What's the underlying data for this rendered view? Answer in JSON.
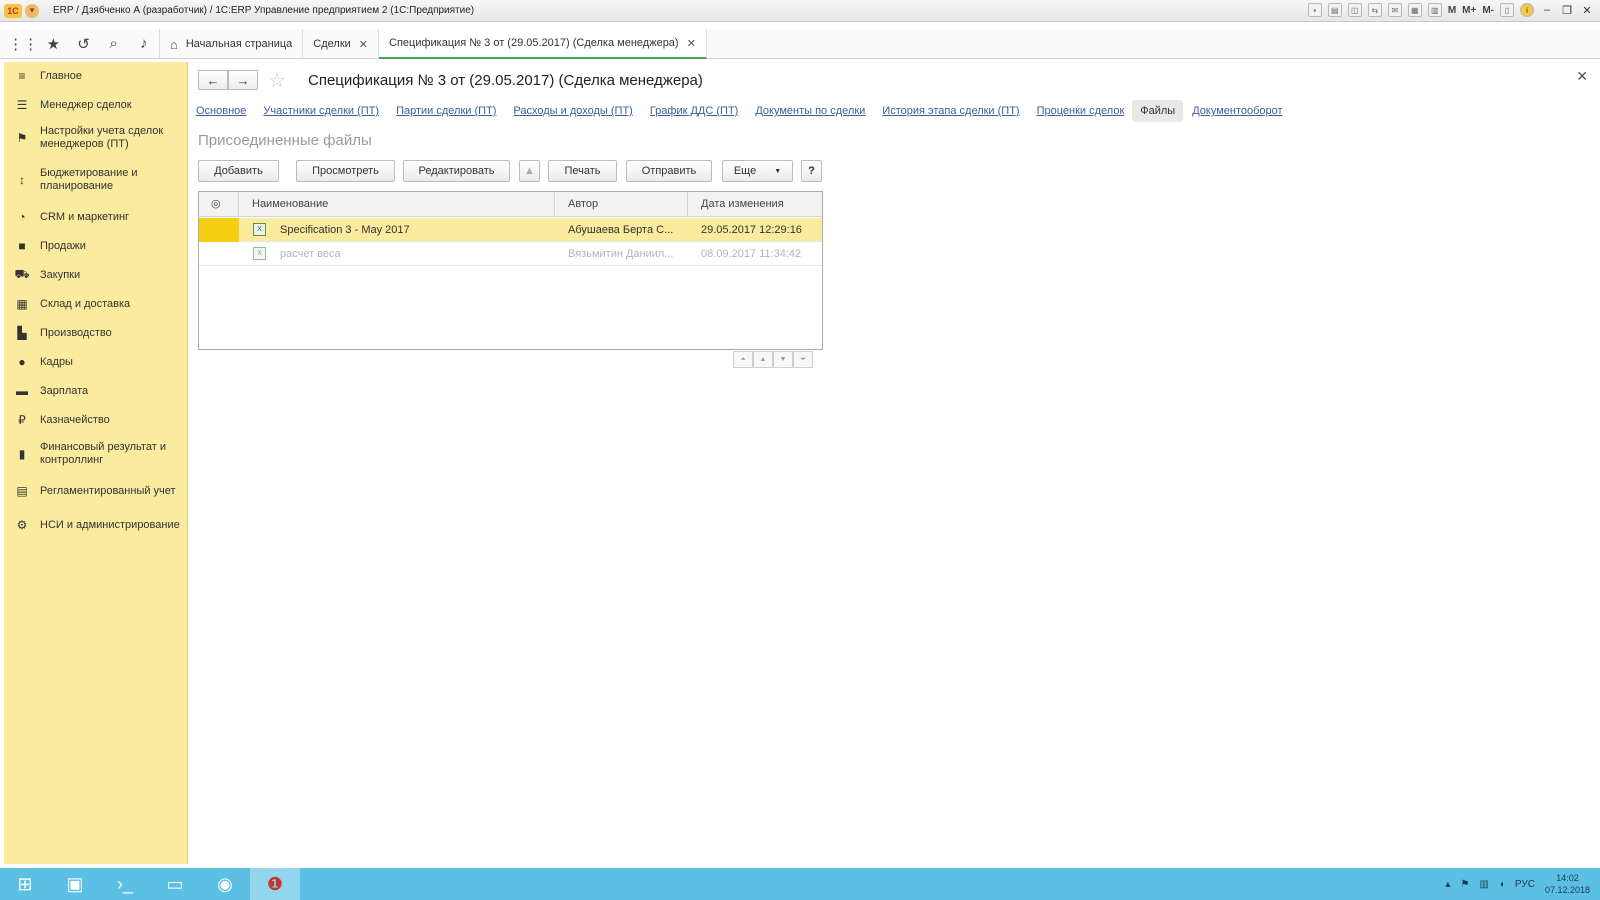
{
  "window": {
    "title": "ERP / Дзябченко А (разработчик) / 1С:ERP Управление предприятием 2  (1С:Предприятие)",
    "right_labels": [
      "M",
      "M+",
      "M-"
    ]
  },
  "tabs": [
    {
      "label": "Начальная страница",
      "icon": "home-icon"
    },
    {
      "label": "Сделки",
      "icon": "close-icon"
    },
    {
      "label": "Спецификация № 3  от (29.05.2017) (Сделка менеджера)",
      "icon": "close-icon",
      "active": true
    }
  ],
  "sidebar": {
    "items": [
      {
        "label": "Главное",
        "icon": "menu-lines-icon"
      },
      {
        "label": "Менеджер сделок",
        "icon": "list-icon"
      },
      {
        "label": "Настройки учета сделок менеджеров (ПТ)",
        "icon": "flag-icon"
      },
      {
        "label": "Бюджетирование и планирование",
        "icon": "budget-icon"
      },
      {
        "label": "CRM и маркетинг",
        "icon": "pie-icon"
      },
      {
        "label": "Продажи",
        "icon": "bag-icon"
      },
      {
        "label": "Закупки",
        "icon": "cart-icon"
      },
      {
        "label": "Склад и доставка",
        "icon": "grid-icon"
      },
      {
        "label": "Производство",
        "icon": "factory-icon"
      },
      {
        "label": "Кадры",
        "icon": "person-icon"
      },
      {
        "label": "Зарплата",
        "icon": "card-icon"
      },
      {
        "label": "Казначейство",
        "icon": "ruble-icon"
      },
      {
        "label": "Финансовый результат и контроллинг",
        "icon": "bar-chart-icon"
      },
      {
        "label": "Регламентированный учет",
        "icon": "ledger-icon"
      },
      {
        "label": "НСИ и администрирование",
        "icon": "gear-icon"
      }
    ]
  },
  "document": {
    "title": "Спецификация № 3  от (29.05.2017) (Сделка менеджера)",
    "subtabs": [
      "Основное",
      "Участники сделки (ПТ)",
      "Партии сделки (ПТ)",
      "Расходы и доходы (ПТ)",
      "График ДДС (ПТ)",
      "Документы по сделки",
      "История этапа сделки (ПТ)",
      "Проценки сделок",
      "Файлы",
      "Документооборот"
    ],
    "section_title": "Присоединенные файлы"
  },
  "commands": {
    "add": "Добавить",
    "view": "Просмотреть",
    "edit": "Редактировать",
    "print": "Печать",
    "send": "Отправить",
    "more": "Еще",
    "help": "?"
  },
  "files_table": {
    "columns": [
      "Наименование",
      "Автор",
      "Дата изменения"
    ],
    "rows": [
      {
        "name": "Specification 3 - May 2017",
        "author": "Абушаева Берта С...",
        "modified": "29.05.2017 12:29:16",
        "selected": true
      },
      {
        "name": "расчет веса",
        "author": "Вязьмитин Даниил...",
        "modified": "08.09.2017 11:34:42",
        "selected": false
      }
    ]
  },
  "taskbar": {
    "lang": "РУС",
    "time": "14:02",
    "date": "07.12.2018"
  }
}
